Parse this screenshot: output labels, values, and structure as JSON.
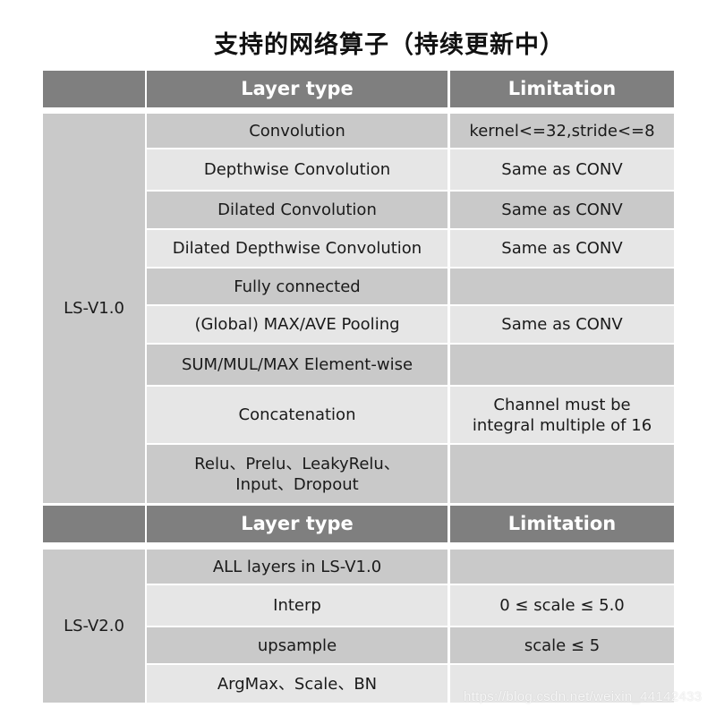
{
  "title": "支持的网络算子（持续更新中）",
  "colors": {
    "header_bg": "#7f7f7f",
    "row_dark": "#c9c9c9",
    "row_light": "#e6e6e6",
    "header_text": "#ffffff"
  },
  "tables": [
    {
      "header": {
        "group": "",
        "layer_type": "Layer type",
        "limitation": "Limitation"
      },
      "group_label": "LS-V1.0",
      "rows": [
        {
          "layer_type": "Convolution",
          "limitation": "kernel<=32,stride<=8"
        },
        {
          "layer_type": "Depthwise Convolution",
          "limitation": "Same as CONV"
        },
        {
          "layer_type": "Dilated Convolution",
          "limitation": "Same as CONV"
        },
        {
          "layer_type": "Dilated Depthwise Convolution",
          "limitation": "Same as CONV"
        },
        {
          "layer_type": "Fully connected",
          "limitation": ""
        },
        {
          "layer_type": "(Global) MAX/AVE Pooling",
          "limitation": "Same as CONV"
        },
        {
          "layer_type": "SUM/MUL/MAX Element-wise",
          "limitation": ""
        },
        {
          "layer_type": "Concatenation",
          "limitation": "Channel must be\nintegral multiple of 16"
        },
        {
          "layer_type": "Relu、Prelu、LeakyRelu、\nInput、Dropout",
          "limitation": ""
        }
      ]
    },
    {
      "header": {
        "group": "",
        "layer_type": "Layer type",
        "limitation": "Limitation"
      },
      "group_label": "LS-V2.0",
      "rows": [
        {
          "layer_type": "ALL layers in LS-V1.0",
          "limitation": ""
        },
        {
          "layer_type": "Interp",
          "limitation": "0 ≤ scale ≤ 5.0"
        },
        {
          "layer_type": "upsample",
          "limitation": "scale ≤ 5"
        },
        {
          "layer_type": "ArgMax、Scale、BN",
          "limitation": ""
        }
      ]
    }
  ],
  "watermark": "https://blog.csdn.net/weixin_44142433"
}
